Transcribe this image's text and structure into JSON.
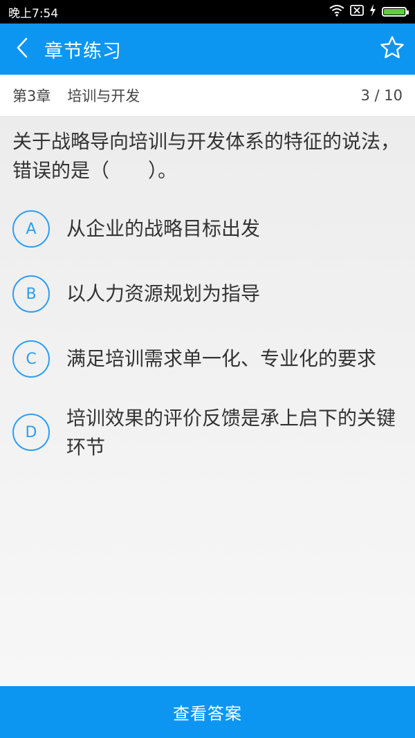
{
  "status_bar": {
    "time": "晚上7:54",
    "icons": [
      "wifi-icon",
      "sim-disabled-icon",
      "charging-icon",
      "battery-icon"
    ],
    "battery_level": 1.0
  },
  "app_bar": {
    "title": "章节练习",
    "back_icon": "chevron-left-icon",
    "favorite_icon": "star-outline-icon",
    "color": "#0c96f2"
  },
  "chapter": {
    "number": "第3章",
    "name": "培训与开发",
    "progress": "3 / 10"
  },
  "question": {
    "text": "关于战略导向培训与开发体系的特征的说法，错误的是（　　）。"
  },
  "options": [
    {
      "letter": "A",
      "text": "从企业的战略目标出发"
    },
    {
      "letter": "B",
      "text": "以人力资源规划为指导"
    },
    {
      "letter": "C",
      "text": "满足培训需求单一化、专业化的要求"
    },
    {
      "letter": "D",
      "text": "培训效果的评价反馈是承上启下的关键环节"
    }
  ],
  "footer": {
    "view_answer_label": "查看答案"
  }
}
